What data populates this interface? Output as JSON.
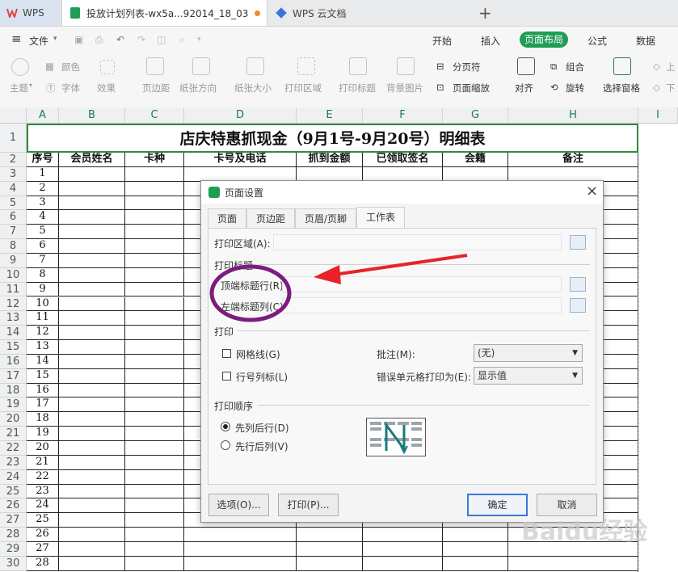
{
  "tabs": {
    "wps_label": "WPS",
    "sheet_label": "投放计划列表-wx5a...92014_18_03",
    "cloud_label": "WPS 云文档",
    "add_label": "+"
  },
  "menu": {
    "file_label": "文件",
    "items": [
      "开始",
      "插入",
      "页面布局",
      "公式",
      "数据"
    ]
  },
  "ribbon": {
    "theme": "主题",
    "colors": "颜色",
    "font": "字体",
    "effects": "效果",
    "margins": "页边距",
    "orientation": "纸张方向",
    "size": "纸张大小",
    "print_area": "打印区域",
    "print_titles": "打印标题",
    "background": "背景图片",
    "page_break": "分页符",
    "page_scale": "页面缩放",
    "align": "对齐",
    "group": "组合",
    "rotate": "旋转",
    "selection_pane": "选择窗格",
    "up": "上",
    "down": "下"
  },
  "sheet": {
    "columns": [
      "A",
      "B",
      "C",
      "D",
      "E",
      "F",
      "G",
      "H",
      "I"
    ],
    "title": "店庆特惠抓现金（9月1号-9月20号）明细表",
    "headers": [
      "序号",
      "会员姓名",
      "卡种",
      "卡号及电话",
      "抓到金额",
      "已领取签名",
      "会籍",
      "备注"
    ],
    "row_numbers": [
      "1",
      "2",
      "3",
      "4",
      "5",
      "6",
      "7",
      "8",
      "9",
      "10",
      "11",
      "12",
      "13",
      "14",
      "15",
      "16",
      "17",
      "18",
      "19",
      "20",
      "21",
      "22",
      "23",
      "24",
      "25",
      "26",
      "27",
      "28",
      "29",
      "30"
    ],
    "serials": [
      "1",
      "2",
      "3",
      "4",
      "5",
      "6",
      "7",
      "8",
      "9",
      "10",
      "11",
      "12",
      "13",
      "14",
      "15",
      "16",
      "17",
      "18",
      "19",
      "20",
      "21",
      "22",
      "23",
      "24",
      "25",
      "26",
      "27",
      "28"
    ]
  },
  "dialog": {
    "title": "页面设置",
    "close": "×",
    "tabs": [
      "页面",
      "页边距",
      "页眉/页脚",
      "工作表"
    ],
    "print_area_label": "打印区域(A):",
    "print_titles_section": "打印标题",
    "top_rows_label": "顶端标题行(R):",
    "left_cols_label": "左端标题列(C):",
    "print_section": "打印",
    "gridlines_label": "网格线(G)",
    "row_col_headers_label": "行号列标(L)",
    "comments_label": "批注(M):",
    "comments_value": "(无)",
    "errors_label": "错误单元格打印为(E):",
    "errors_value": "显示值",
    "order_section": "打印顺序",
    "down_then_over": "先列后行(D)",
    "over_then_down": "先行后列(V)",
    "options_button": "选项(O)...",
    "print_button": "打印(P)...",
    "ok_button": "确定",
    "cancel_button": "取消"
  },
  "watermark": "Baidu经验",
  "colors": {
    "accent_green": "#1f9d55",
    "annotation_purple": "#7b1d7e",
    "annotation_red": "#e8232a"
  }
}
